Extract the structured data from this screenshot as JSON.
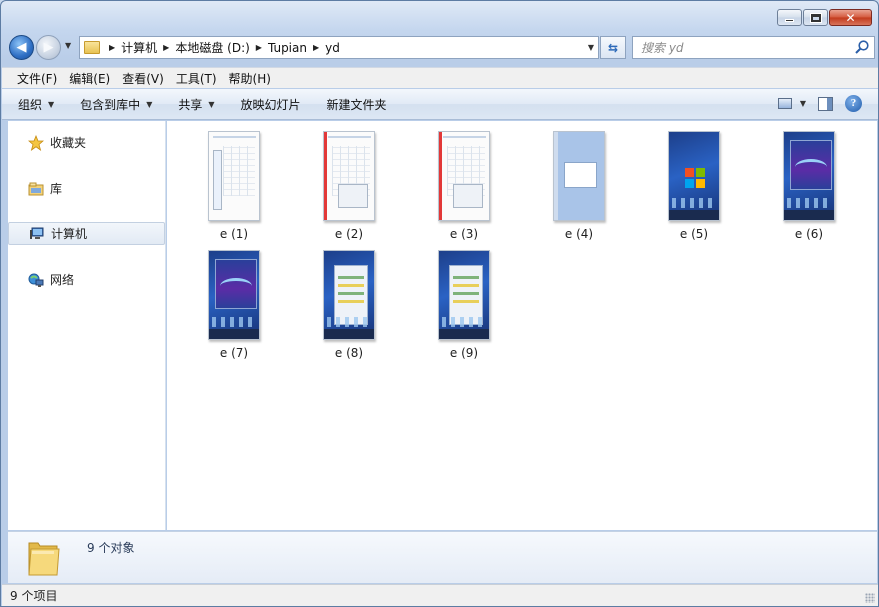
{
  "breadcrumb": [
    "计算机",
    "本地磁盘 (D:)",
    "Tupian",
    "yd"
  ],
  "search": {
    "placeholder": "搜索 yd"
  },
  "menu": [
    "文件(F)",
    "编辑(E)",
    "查看(V)",
    "工具(T)",
    "帮助(H)"
  ],
  "commands": [
    {
      "label": "组织",
      "dropdown": true
    },
    {
      "label": "包含到库中",
      "dropdown": true
    },
    {
      "label": "共享",
      "dropdown": true
    },
    {
      "label": "放映幻灯片",
      "dropdown": false
    },
    {
      "label": "新建文件夹",
      "dropdown": false
    }
  ],
  "sidebar": {
    "items": [
      {
        "label": "收藏夹",
        "icon": "star-icon"
      },
      {
        "label": "库",
        "icon": "library-icon"
      },
      {
        "label": "计算机",
        "icon": "computer-icon",
        "selected": true
      },
      {
        "label": "网络",
        "icon": "network-icon"
      }
    ]
  },
  "files": [
    {
      "name": "e (1)",
      "preview": "document"
    },
    {
      "name": "e (2)",
      "preview": "document"
    },
    {
      "name": "e (3)",
      "preview": "document"
    },
    {
      "name": "e (4)",
      "preview": "blank-window"
    },
    {
      "name": "e (5)",
      "preview": "desktop-logo"
    },
    {
      "name": "e (6)",
      "preview": "desktop-purple"
    },
    {
      "name": "e (7)",
      "preview": "desktop-purple"
    },
    {
      "name": "e (8)",
      "preview": "desktop-window"
    },
    {
      "name": "e (9)",
      "preview": "desktop-window"
    }
  ],
  "details": {
    "count_text": "9 个对象"
  },
  "status": {
    "text": "9 个项目"
  },
  "colors": {
    "accent": "#2f6fc4",
    "selection": "#e2eaf4"
  }
}
